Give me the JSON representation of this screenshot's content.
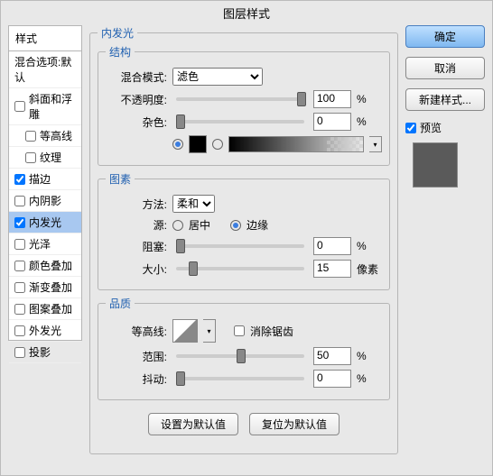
{
  "title": "图层样式",
  "styles": {
    "header": "样式",
    "blend_default": "混合选项:默认",
    "items": [
      {
        "label": "斜面和浮雕",
        "checked": false,
        "indent": false
      },
      {
        "label": "等高线",
        "checked": false,
        "indent": true
      },
      {
        "label": "纹理",
        "checked": false,
        "indent": true
      },
      {
        "label": "描边",
        "checked": true,
        "indent": false
      },
      {
        "label": "内阴影",
        "checked": false,
        "indent": false
      },
      {
        "label": "内发光",
        "checked": true,
        "indent": false,
        "selected": true
      },
      {
        "label": "光泽",
        "checked": false,
        "indent": false
      },
      {
        "label": "颜色叠加",
        "checked": false,
        "indent": false
      },
      {
        "label": "渐变叠加",
        "checked": false,
        "indent": false
      },
      {
        "label": "图案叠加",
        "checked": false,
        "indent": false
      },
      {
        "label": "外发光",
        "checked": false,
        "indent": false
      },
      {
        "label": "投影",
        "checked": false,
        "indent": false
      }
    ]
  },
  "panel": {
    "title": "内发光",
    "structure": {
      "legend": "结构",
      "blend_mode_label": "混合模式:",
      "blend_mode_value": "滤色",
      "opacity_label": "不透明度:",
      "opacity_value": "100",
      "noise_label": "杂色:",
      "noise_value": "0",
      "unit_pct": "%"
    },
    "elements": {
      "legend": "图素",
      "method_label": "方法:",
      "method_value": "柔和",
      "source_label": "源:",
      "source_center": "居中",
      "source_edge": "边缘",
      "choke_label": "阻塞:",
      "choke_value": "0",
      "size_label": "大小:",
      "size_value": "15",
      "unit_pct": "%",
      "unit_px": "像素"
    },
    "quality": {
      "legend": "品质",
      "contour_label": "等高线:",
      "antialias_label": "消除锯齿",
      "range_label": "范围:",
      "range_value": "50",
      "jitter_label": "抖动:",
      "jitter_value": "0",
      "unit_pct": "%"
    },
    "buttons": {
      "set_default": "设置为默认值",
      "reset_default": "复位为默认值"
    }
  },
  "right": {
    "ok": "确定",
    "cancel": "取消",
    "new_style": "新建样式...",
    "preview": "预览"
  }
}
